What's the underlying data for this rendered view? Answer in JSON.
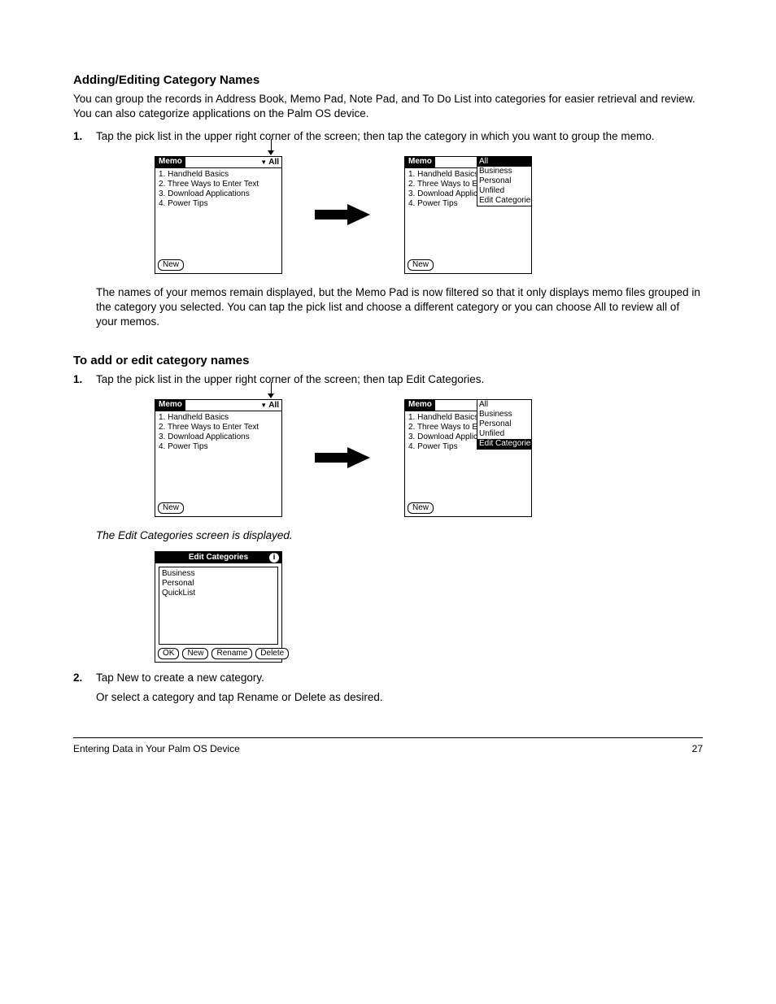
{
  "headings": {
    "sec1": "Adding/Editing Category Names",
    "sec2": "To add or edit category names"
  },
  "paragraphs": {
    "p1": "You can group the records in Address Book, Memo Pad, Note Pad, and To Do List into categories for easier retrieval and review. You can also categorize applications on the Palm OS device.",
    "s1_1": "Tap the pick list in the upper right corner of the screen; then tap the category in which you want to group the memo.",
    "s1_note": "The names of your memos remain displayed, but the Memo Pad is now filtered so that it only displays memo files grouped in the category you selected. You can tap the pick list and choose a different category or you can choose All to review all of your memos.",
    "s2_1": "Tap the pick list in the upper right corner of the screen; then tap Edit Categories.",
    "s2_result": "The Edit Categories screen is displayed.",
    "s2_2": "Tap New to create a new category.",
    "s2_or": "Or select a category and tap Rename or Delete as desired."
  },
  "device": {
    "title": "Memo",
    "cat_label": "All",
    "memos": [
      "1. Handheld Basics",
      "2. Three Ways to Enter Text",
      "3. Download Applications",
      "4. Power Tips"
    ],
    "memos_trunc": [
      "1. Handheld Basics",
      "2. Three Ways to E",
      "3. Download Applic",
      "4. Power Tips"
    ],
    "new_btn": "New"
  },
  "dropdown1": {
    "items": [
      "All",
      "Business",
      "Personal",
      "Unfiled",
      "Edit Categories..."
    ],
    "selected_index": 0
  },
  "dropdown2": {
    "items": [
      "All",
      "Business",
      "Personal",
      "Unfiled",
      "Edit Categories..."
    ],
    "selected_index": 4
  },
  "dialog": {
    "title": "Edit Categories",
    "items": [
      "Business",
      "Personal",
      "QuickList"
    ],
    "buttons": {
      "ok": "OK",
      "new": "New",
      "rename": "Rename",
      "delete": "Delete"
    }
  },
  "footer": {
    "left": "Entering Data in Your Palm OS Device",
    "right": "27",
    "copyright": ""
  }
}
